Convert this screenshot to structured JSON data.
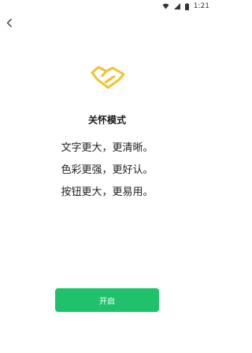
{
  "status_bar": {
    "time": "1:21",
    "icons": [
      "wifi-icon",
      "signal-icon",
      "battery-icon"
    ]
  },
  "nav": {
    "back_icon": "chevron-left-icon"
  },
  "hero": {
    "icon": "handshake-icon",
    "accent_color": "#f1c232"
  },
  "title": "关怀模式",
  "features": [
    "文字更大，更清晰。",
    "色彩更强，更好认。",
    "按钮更大，更易用。"
  ],
  "enable_button": {
    "label": "开启",
    "color": "#1fc26b"
  }
}
